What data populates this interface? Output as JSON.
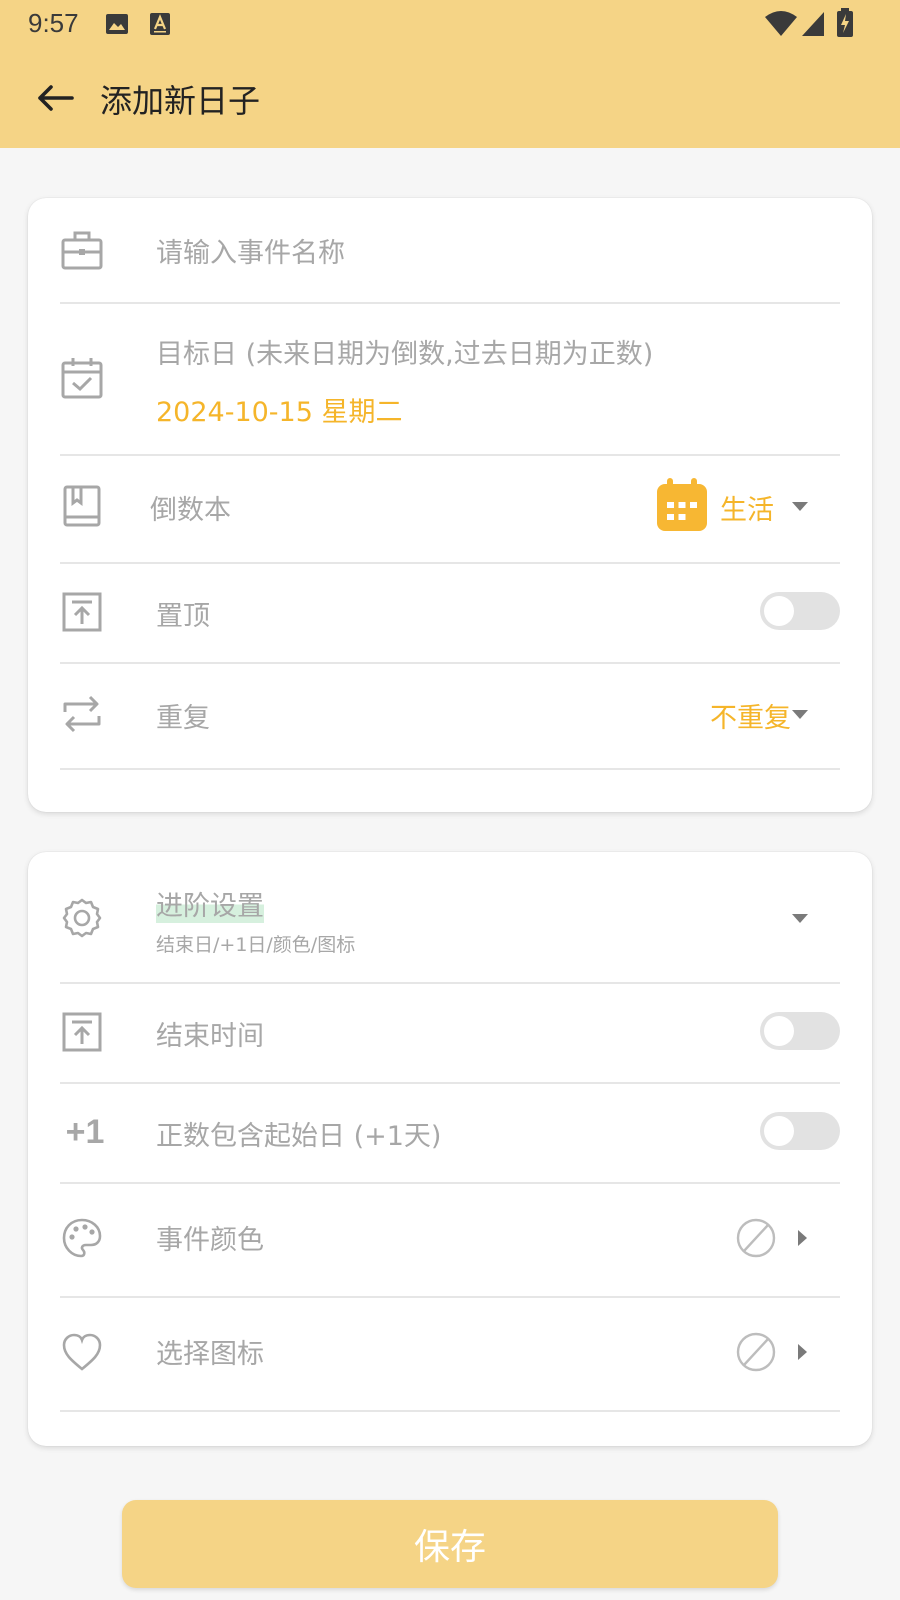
{
  "status_bar": {
    "time": "9:57"
  },
  "app_bar": {
    "title": "添加新日子"
  },
  "form": {
    "event_name_placeholder": "请输入事件名称",
    "target_date_label": "目标日 (未来日期为倒数,过去日期为正数)",
    "target_date_value": "2024-10-15 星期二",
    "book_label": "倒数本",
    "book_value": "生活",
    "pin_label": "置顶",
    "pin_on": false,
    "repeat_label": "重复",
    "repeat_value": "不重复"
  },
  "advanced": {
    "title": "进阶设置",
    "subtitle": "结束日/+1日/颜色/图标",
    "end_time_label": "结束时间",
    "end_time_on": false,
    "plus_one_icon_text": "+1",
    "plus_one_label": "正数包含起始日 (+1天)",
    "plus_one_on": false,
    "color_label": "事件颜色",
    "icon_label": "选择图标"
  },
  "save_label": "保存",
  "colors": {
    "header_bg": "#F5D486",
    "accent": "#F5B52A",
    "calendar_icon": "#F7B733",
    "muted_text": "#A7A7A7",
    "toggle_track": "#E2E2E2"
  }
}
